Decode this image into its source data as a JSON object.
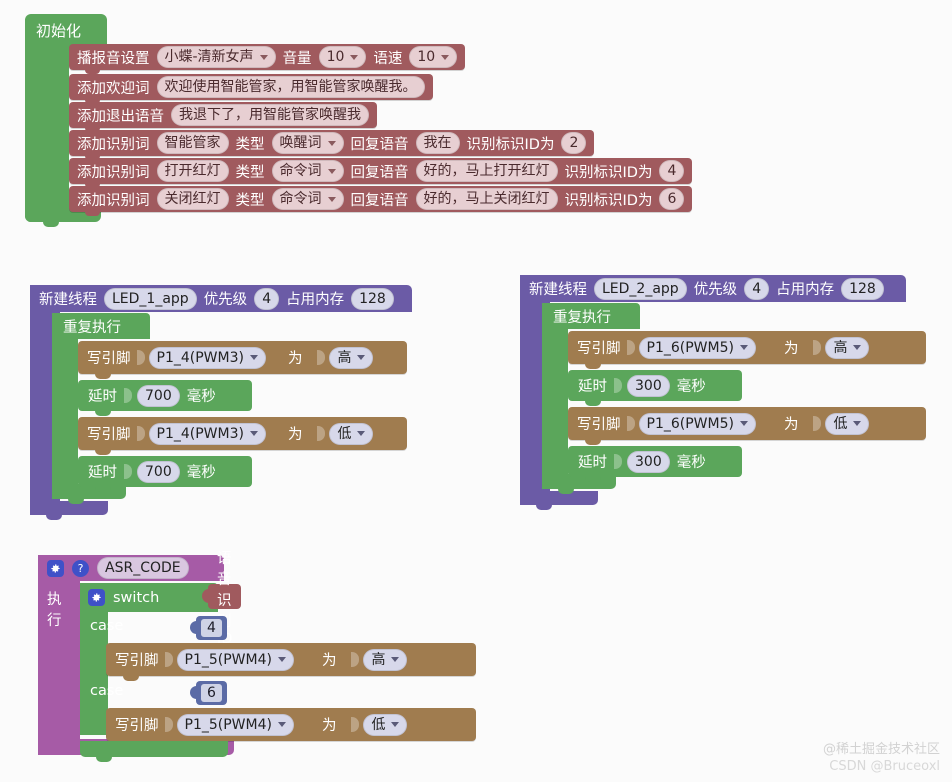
{
  "watermark": {
    "line1": "@稀土掘金技术社区",
    "line2": "CSDN @Bruceoxl"
  },
  "init_block": {
    "hat_label": "初始化",
    "rows": [
      {
        "label": "播报音设置",
        "fields": [
          {
            "kind": "dropdown",
            "value": "小蝶-清新女声"
          },
          {
            "kind": "label",
            "value": "音量"
          },
          {
            "kind": "dropdown",
            "value": "10"
          },
          {
            "kind": "label",
            "value": "语速"
          },
          {
            "kind": "dropdown",
            "value": "10"
          }
        ]
      },
      {
        "label": "添加欢迎词",
        "fields": [
          {
            "kind": "text",
            "value": "欢迎使用智能管家，用智能管家唤醒我。"
          }
        ]
      },
      {
        "label": "添加退出语音",
        "fields": [
          {
            "kind": "text",
            "value": "我退下了，用智能管家唤醒我"
          }
        ]
      },
      {
        "label": "添加识别词",
        "fields": [
          {
            "kind": "text",
            "value": "智能管家"
          },
          {
            "kind": "label",
            "value": "类型"
          },
          {
            "kind": "dropdown",
            "value": "唤醒词"
          },
          {
            "kind": "label",
            "value": "回复语音"
          },
          {
            "kind": "text",
            "value": "我在"
          },
          {
            "kind": "label",
            "value": "识别标识ID为"
          },
          {
            "kind": "num",
            "value": "2"
          }
        ]
      },
      {
        "label": "添加识别词",
        "fields": [
          {
            "kind": "text",
            "value": "打开红灯"
          },
          {
            "kind": "label",
            "value": "类型"
          },
          {
            "kind": "dropdown",
            "value": "命令词"
          },
          {
            "kind": "label",
            "value": "回复语音"
          },
          {
            "kind": "text",
            "value": "好的，马上打开红灯"
          },
          {
            "kind": "label",
            "value": "识别标识ID为"
          },
          {
            "kind": "num",
            "value": "4"
          }
        ]
      },
      {
        "label": "添加识别词",
        "fields": [
          {
            "kind": "text",
            "value": "关闭红灯"
          },
          {
            "kind": "label",
            "value": "类型"
          },
          {
            "kind": "dropdown",
            "value": "命令词"
          },
          {
            "kind": "label",
            "value": "回复语音"
          },
          {
            "kind": "text",
            "value": "好的，马上关闭红灯"
          },
          {
            "kind": "label",
            "value": "识别标识ID为"
          },
          {
            "kind": "num",
            "value": "6"
          }
        ]
      }
    ]
  },
  "thread1": {
    "header_label": "新建线程",
    "name": "LED_1_app",
    "priority_label": "优先级",
    "priority": "4",
    "memory_label": "占用内存",
    "memory": "128",
    "loop_label": "重复执行",
    "statements": [
      {
        "type": "pin_write",
        "label": "写引脚",
        "pin": "P1_4(PWM3)",
        "mid": "为",
        "level": "高"
      },
      {
        "type": "delay",
        "label": "延时",
        "value": "700",
        "unit": "毫秒"
      },
      {
        "type": "pin_write",
        "label": "写引脚",
        "pin": "P1_4(PWM3)",
        "mid": "为",
        "level": "低"
      },
      {
        "type": "delay",
        "label": "延时",
        "value": "700",
        "unit": "毫秒"
      }
    ]
  },
  "thread2": {
    "header_label": "新建线程",
    "name": "LED_2_app",
    "priority_label": "优先级",
    "priority": "4",
    "memory_label": "占用内存",
    "memory": "128",
    "loop_label": "重复执行",
    "statements": [
      {
        "type": "pin_write",
        "label": "写引脚",
        "pin": "P1_6(PWM5)",
        "mid": "为",
        "level": "高"
      },
      {
        "type": "delay",
        "label": "延时",
        "value": "300",
        "unit": "毫秒"
      },
      {
        "type": "pin_write",
        "label": "写引脚",
        "pin": "P1_6(PWM5)",
        "mid": "为",
        "level": "低"
      },
      {
        "type": "delay",
        "label": "延时",
        "value": "300",
        "unit": "毫秒"
      }
    ]
  },
  "asr_block": {
    "title": "ASR_CODE",
    "exec_label": "执行",
    "switch_label": "switch",
    "switch_value": "语音识别ID",
    "cases": [
      {
        "case_label": "case",
        "case_value": "4",
        "statement": {
          "label": "写引脚",
          "pin": "P1_5(PWM4)",
          "mid": "为",
          "level": "高"
        }
      },
      {
        "case_label": "case",
        "case_value": "6",
        "statement": {
          "label": "写引脚",
          "pin": "P1_5(PWM4)",
          "mid": "为",
          "level": "低"
        }
      }
    ]
  },
  "colors": {
    "green": "#5ba65b",
    "maroon": "#a05a5e",
    "purple": "#6b5ba6",
    "magenta": "#a65ba6",
    "brown": "#a07c4f",
    "blue": "#5b6ba6",
    "background": "#fbfbfb"
  }
}
